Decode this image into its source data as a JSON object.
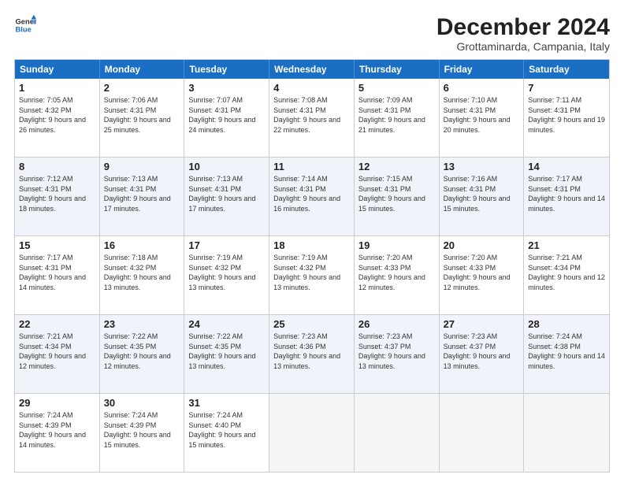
{
  "logo": {
    "line1": "General",
    "line2": "Blue"
  },
  "title": "December 2024",
  "subtitle": "Grottaminarda, Campania, Italy",
  "days_of_week": [
    "Sunday",
    "Monday",
    "Tuesday",
    "Wednesday",
    "Thursday",
    "Friday",
    "Saturday"
  ],
  "weeks": [
    [
      {
        "day": "1",
        "sunrise": "7:05 AM",
        "sunset": "4:32 PM",
        "daylight": "9 hours and 26 minutes."
      },
      {
        "day": "2",
        "sunrise": "7:06 AM",
        "sunset": "4:31 PM",
        "daylight": "9 hours and 25 minutes."
      },
      {
        "day": "3",
        "sunrise": "7:07 AM",
        "sunset": "4:31 PM",
        "daylight": "9 hours and 24 minutes."
      },
      {
        "day": "4",
        "sunrise": "7:08 AM",
        "sunset": "4:31 PM",
        "daylight": "9 hours and 22 minutes."
      },
      {
        "day": "5",
        "sunrise": "7:09 AM",
        "sunset": "4:31 PM",
        "daylight": "9 hours and 21 minutes."
      },
      {
        "day": "6",
        "sunrise": "7:10 AM",
        "sunset": "4:31 PM",
        "daylight": "9 hours and 20 minutes."
      },
      {
        "day": "7",
        "sunrise": "7:11 AM",
        "sunset": "4:31 PM",
        "daylight": "9 hours and 19 minutes."
      }
    ],
    [
      {
        "day": "8",
        "sunrise": "7:12 AM",
        "sunset": "4:31 PM",
        "daylight": "9 hours and 18 minutes."
      },
      {
        "day": "9",
        "sunrise": "7:13 AM",
        "sunset": "4:31 PM",
        "daylight": "9 hours and 17 minutes."
      },
      {
        "day": "10",
        "sunrise": "7:13 AM",
        "sunset": "4:31 PM",
        "daylight": "9 hours and 17 minutes."
      },
      {
        "day": "11",
        "sunrise": "7:14 AM",
        "sunset": "4:31 PM",
        "daylight": "9 hours and 16 minutes."
      },
      {
        "day": "12",
        "sunrise": "7:15 AM",
        "sunset": "4:31 PM",
        "daylight": "9 hours and 15 minutes."
      },
      {
        "day": "13",
        "sunrise": "7:16 AM",
        "sunset": "4:31 PM",
        "daylight": "9 hours and 15 minutes."
      },
      {
        "day": "14",
        "sunrise": "7:17 AM",
        "sunset": "4:31 PM",
        "daylight": "9 hours and 14 minutes."
      }
    ],
    [
      {
        "day": "15",
        "sunrise": "7:17 AM",
        "sunset": "4:31 PM",
        "daylight": "9 hours and 14 minutes."
      },
      {
        "day": "16",
        "sunrise": "7:18 AM",
        "sunset": "4:32 PM",
        "daylight": "9 hours and 13 minutes."
      },
      {
        "day": "17",
        "sunrise": "7:19 AM",
        "sunset": "4:32 PM",
        "daylight": "9 hours and 13 minutes."
      },
      {
        "day": "18",
        "sunrise": "7:19 AM",
        "sunset": "4:32 PM",
        "daylight": "9 hours and 13 minutes."
      },
      {
        "day": "19",
        "sunrise": "7:20 AM",
        "sunset": "4:33 PM",
        "daylight": "9 hours and 12 minutes."
      },
      {
        "day": "20",
        "sunrise": "7:20 AM",
        "sunset": "4:33 PM",
        "daylight": "9 hours and 12 minutes."
      },
      {
        "day": "21",
        "sunrise": "7:21 AM",
        "sunset": "4:34 PM",
        "daylight": "9 hours and 12 minutes."
      }
    ],
    [
      {
        "day": "22",
        "sunrise": "7:21 AM",
        "sunset": "4:34 PM",
        "daylight": "9 hours and 12 minutes."
      },
      {
        "day": "23",
        "sunrise": "7:22 AM",
        "sunset": "4:35 PM",
        "daylight": "9 hours and 12 minutes."
      },
      {
        "day": "24",
        "sunrise": "7:22 AM",
        "sunset": "4:35 PM",
        "daylight": "9 hours and 13 minutes."
      },
      {
        "day": "25",
        "sunrise": "7:23 AM",
        "sunset": "4:36 PM",
        "daylight": "9 hours and 13 minutes."
      },
      {
        "day": "26",
        "sunrise": "7:23 AM",
        "sunset": "4:37 PM",
        "daylight": "9 hours and 13 minutes."
      },
      {
        "day": "27",
        "sunrise": "7:23 AM",
        "sunset": "4:37 PM",
        "daylight": "9 hours and 13 minutes."
      },
      {
        "day": "28",
        "sunrise": "7:24 AM",
        "sunset": "4:38 PM",
        "daylight": "9 hours and 14 minutes."
      }
    ],
    [
      {
        "day": "29",
        "sunrise": "7:24 AM",
        "sunset": "4:39 PM",
        "daylight": "9 hours and 14 minutes."
      },
      {
        "day": "30",
        "sunrise": "7:24 AM",
        "sunset": "4:39 PM",
        "daylight": "9 hours and 15 minutes."
      },
      {
        "day": "31",
        "sunrise": "7:24 AM",
        "sunset": "4:40 PM",
        "daylight": "9 hours and 15 minutes."
      },
      null,
      null,
      null,
      null
    ]
  ],
  "labels": {
    "sunrise": "Sunrise:",
    "sunset": "Sunset:",
    "daylight": "Daylight:"
  }
}
